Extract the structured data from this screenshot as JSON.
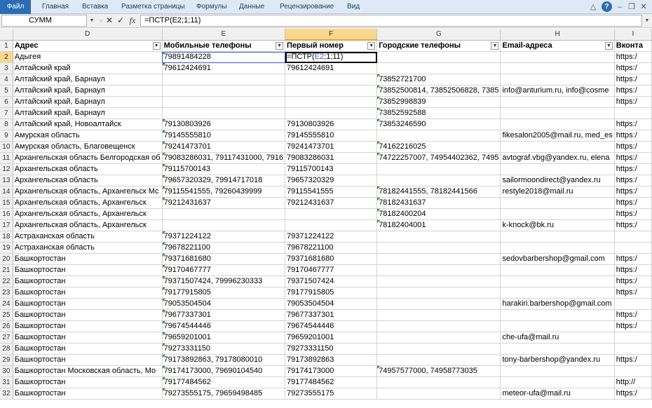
{
  "ribbon": {
    "tabs": [
      "Файл",
      "Главная",
      "Вставка",
      "Разметка страницы",
      "Формулы",
      "Данные",
      "Рецензирование",
      "Вид"
    ],
    "help": "?"
  },
  "formula_bar": {
    "name_box": "СУММ",
    "cancel": "✕",
    "enter": "✓",
    "fx": "fx",
    "formula": "=ПСТР(E2;1;11)"
  },
  "columns": [
    "D",
    "E",
    "F",
    "G",
    "H",
    "I"
  ],
  "header_row": {
    "num": "1",
    "cells": [
      "Адрес",
      "Мобильные телефоны",
      "Первый номер",
      "Городские телефоны",
      "Email-адреса",
      "Вконта"
    ]
  },
  "active_cell": {
    "prefix": "=ПСТР(",
    "ref": "E2",
    "suffix": ";1;11)"
  },
  "rows": [
    {
      "num": "2",
      "d": "Адыгея",
      "e": "79891484228",
      "f": "",
      "g": "",
      "h": "",
      "i": "https:/"
    },
    {
      "num": "3",
      "d": "Алтайский край",
      "e": "79612424691",
      "f": "79612424691",
      "g": "",
      "h": "",
      "i": "https:/"
    },
    {
      "num": "4",
      "d": "Алтайский край, Барнаул",
      "e": "",
      "f": "",
      "g": "73852721700",
      "h": "",
      "i": "https:/"
    },
    {
      "num": "5",
      "d": "Алтайский край, Барнаул",
      "e": "",
      "f": "",
      "g": "73852500814, 73852506828, 7385",
      "h": "info@anturium.ru, info@cosme",
      "i": "https:/"
    },
    {
      "num": "6",
      "d": "Алтайский край, Барнаул",
      "e": "",
      "f": "",
      "g": "73852998839",
      "h": "",
      "i": "https:/"
    },
    {
      "num": "7",
      "d": "Алтайский край, Барнаул",
      "e": "",
      "f": "",
      "g": "73852592588",
      "h": "",
      "i": ""
    },
    {
      "num": "8",
      "d": "Алтайский край, Новоалтайск",
      "e": "79130803926",
      "f": "79130803926",
      "g": "73853246590",
      "h": "",
      "i": "https:/"
    },
    {
      "num": "9",
      "d": "Амурская область",
      "e": "79145555810",
      "f": "79145555810",
      "g": "",
      "h": "fikesalon2005@mail.ru, med_es",
      "i": "https:/"
    },
    {
      "num": "10",
      "d": "Амурская область, Благовещенск",
      "e": "79241473701",
      "f": "79241473701",
      "g": "74162216025",
      "h": "",
      "i": "https:/"
    },
    {
      "num": "11",
      "d": "Архангельская область Белгородская об",
      "e": "79083286031, 79117431000, 7916",
      "f": "79083286031",
      "g": "74722257007, 74954402362, 7495",
      "h": "avtograf.vbg@yandex.ru, elena",
      "i": "https:/"
    },
    {
      "num": "12",
      "d": "Архангельская область",
      "e": "79115700143",
      "f": "79115700143",
      "g": "",
      "h": "",
      "i": "https:/"
    },
    {
      "num": "13",
      "d": "Архангельская область",
      "e": "79657320329, 79914717018",
      "f": "79657320329",
      "g": "",
      "h": "sailormoondirect@yandex.ru",
      "i": "https:/"
    },
    {
      "num": "14",
      "d": "Архангельская область, Архангельск Мс",
      "e": "79115541555, 79260439999",
      "f": "79115541555",
      "g": "78182441555, 78182441566",
      "h": "restyle2018@mail.ru",
      "i": "https:/"
    },
    {
      "num": "15",
      "d": "Архангельская область, Архангельск",
      "e": "79212431637",
      "f": "79212431637",
      "g": "78182431637",
      "h": "",
      "i": "https:/"
    },
    {
      "num": "16",
      "d": "Архангельская область, Архангельск",
      "e": "",
      "f": "",
      "g": "78182400204",
      "h": "",
      "i": "https:/"
    },
    {
      "num": "17",
      "d": "Архангельская область, Архангельск",
      "e": "",
      "f": "",
      "g": "78182404001",
      "h": "k-knock@bk.ru",
      "i": "https:/"
    },
    {
      "num": "18",
      "d": "Астраханская область",
      "e": "79371224122",
      "f": "79371224122",
      "g": "",
      "h": "",
      "i": ""
    },
    {
      "num": "19",
      "d": "Астраханская область",
      "e": "79678221100",
      "f": "79678221100",
      "g": "",
      "h": "",
      "i": ""
    },
    {
      "num": "20",
      "d": "Башкортостан",
      "e": "79371681680",
      "f": "79371681680",
      "g": "",
      "h": "sedovbarbershop@gmail.com",
      "i": "https:/"
    },
    {
      "num": "21",
      "d": "Башкортостан",
      "e": "79170467777",
      "f": "79170467777",
      "g": "",
      "h": "",
      "i": "https:/"
    },
    {
      "num": "22",
      "d": "Башкортостан",
      "e": "79371507424, 79996230333",
      "f": "79371507424",
      "g": "",
      "h": "",
      "i": "https:/"
    },
    {
      "num": "23",
      "d": "Башкортостан",
      "e": "79177915805",
      "f": "79177915805",
      "g": "",
      "h": "",
      "i": "https:/"
    },
    {
      "num": "24",
      "d": "Башкортостан",
      "e": "79053504504",
      "f": "79053504504",
      "g": "",
      "h": "harakiri.barbershop@gmail.com",
      "i": ""
    },
    {
      "num": "25",
      "d": "Башкортостан",
      "e": "79677337301",
      "f": "79677337301",
      "g": "",
      "h": "",
      "i": "https:/"
    },
    {
      "num": "26",
      "d": "Башкортостан",
      "e": "79674544446",
      "f": "79674544446",
      "g": "",
      "h": "",
      "i": "https:/"
    },
    {
      "num": "27",
      "d": "Башкортостан",
      "e": "79659201001",
      "f": "79659201001",
      "g": "",
      "h": "che-ufa@mail.ru",
      "i": ""
    },
    {
      "num": "28",
      "d": "Башкортостан",
      "e": "79273331150",
      "f": "79273331150",
      "g": "",
      "h": "",
      "i": ""
    },
    {
      "num": "29",
      "d": "Башкортостан",
      "e": "79173892863, 79178080010",
      "f": "79173892863",
      "g": "",
      "h": "tony-barbershop@yandex.ru",
      "i": "https:/"
    },
    {
      "num": "30",
      "d": "Башкортостан Московская область, Мо",
      "e": "79174173000, 79690104540",
      "f": "79174173000",
      "g": "74957577000, 74958773035",
      "h": "",
      "i": ""
    },
    {
      "num": "31",
      "d": "Башкортостан",
      "e": "79177484562",
      "f": "79177484562",
      "g": "",
      "h": "",
      "i": "http://"
    },
    {
      "num": "32",
      "d": "Башкортостан",
      "e": "79273555175, 79659498485",
      "f": "79273555175",
      "g": "",
      "h": "meteor-ufa@mail.ru",
      "i": "https:/"
    }
  ]
}
